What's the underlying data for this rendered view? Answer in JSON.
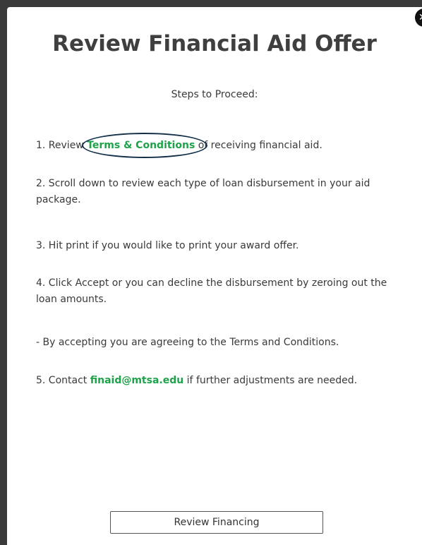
{
  "modal": {
    "title": "Review Financial Aid Offer",
    "subtitle": "Steps to Proceed:",
    "close_label": "✕"
  },
  "steps": {
    "s1_prefix": "1. Review ",
    "s1_link": "Terms & Conditions",
    "s1_suffix": " of receiving financial aid.",
    "s2": "2. Scroll down to review each type of loan disbursement in your aid package.",
    "s3": "3. Hit print if you would like to print your award offer.",
    "s4": "4. Click Accept or you can decline the disbursement by zeroing out the loan amounts.",
    "s4_note": "- By accepting you are agreeing to the Terms and Conditions.",
    "s5_prefix": "5. Contact ",
    "s5_link": "finaid@mtsa.edu",
    "s5_suffix": " if further adjustments are needed."
  },
  "actions": {
    "review_label": "Review Financing"
  },
  "colors": {
    "link": "#1ea34a",
    "title": "#3f3f3f",
    "highlight": "#13304a"
  }
}
